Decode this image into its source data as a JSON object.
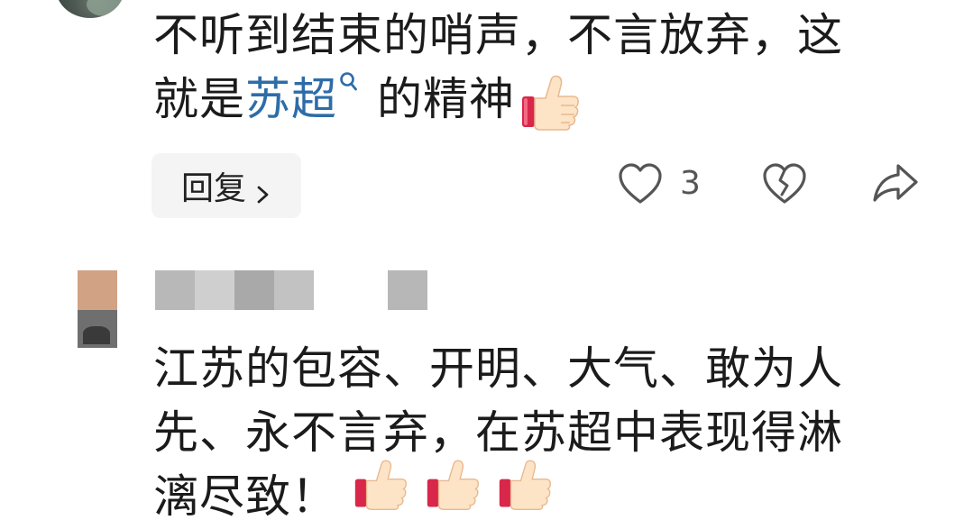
{
  "comment1": {
    "line1": "不听到结束的哨声，不言放弃，这",
    "line2_prefix": "就是",
    "link_text": "苏超",
    "line2_suffix": "的精神",
    "emoji": "thumbs-up-emoji",
    "reply_label": "回复",
    "like_count": "3"
  },
  "comment2": {
    "username": "■■■■■ ■",
    "line1": "江苏的包容、开明、大气、敢为人",
    "line2": "先、永不言弃，在苏超中表现得淋",
    "line3": "漓尽致！",
    "emojis": [
      "thumbs-up-emoji",
      "thumbs-up-emoji",
      "thumbs-up-emoji"
    ]
  },
  "icons": {
    "like": "heart-outline-icon",
    "dislike": "broken-heart-icon",
    "share": "share-arrow-icon",
    "search_link": "search-link-icon",
    "reply_chevron": "chevron-right-icon"
  },
  "colors": {
    "link": "#2e6ca8",
    "text": "#1b1b1b",
    "reply_bg": "#f4f4f4",
    "icon": "#555555"
  }
}
